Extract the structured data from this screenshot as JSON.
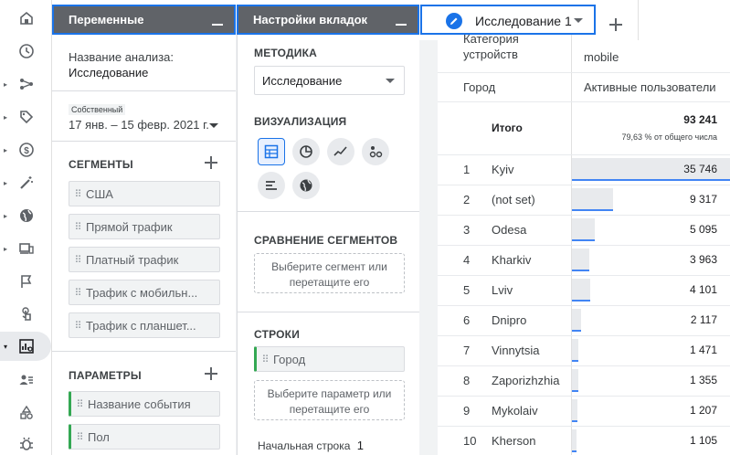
{
  "variables_panel": {
    "title": "Переменные",
    "analysis_name_label": "Название анализа:",
    "analysis_name_value": "Исследование",
    "date_badge": "Собственный",
    "date_range": "17 янв. – 15 февр. 2021 г.",
    "segments_title": "СЕГМЕНТЫ",
    "segments": [
      "США",
      "Прямой трафик",
      "Платный трафик",
      "Трафик с мобильн...",
      "Трафик с планшет..."
    ],
    "params_title": "ПАРАМЕТРЫ",
    "params": [
      "Название события",
      "Пол"
    ]
  },
  "settings_panel": {
    "title": "Настройки вкладок",
    "method_title": "МЕТОДИКА",
    "method_value": "Исследование",
    "viz_title": "ВИЗУАЛИЗАЦИЯ",
    "viz_icons": [
      "table-icon",
      "donut-chart-icon",
      "line-chart-icon",
      "scatter-chart-icon",
      "bar-chart-icon",
      "globe-icon"
    ],
    "segment_compare_title": "СРАВНЕНИЕ СЕГМЕНТОВ",
    "segment_drop_l1": "Выберите сегмент или",
    "segment_drop_l2": "перетащите его",
    "rows_title": "СТРОКИ",
    "rows_item": "Город",
    "rows_drop_l1": "Выберите параметр или",
    "rows_drop_l2": "перетащите его",
    "start_row_label": "Начальная строка",
    "start_row_value": "1"
  },
  "tab": {
    "label": "Исследование 1"
  },
  "table": {
    "device_category_header_l1": "Категория",
    "device_category_header_l2": "устройств",
    "device_value": "mobile",
    "city_header": "Город",
    "metric_header": "Активные пользователи",
    "total_label": "Итого",
    "total_value": "93 241",
    "total_sub": "79,63 % от общего числа",
    "rows": [
      {
        "n": "1",
        "city": "Kyiv",
        "value": "35 746",
        "share": 1.0
      },
      {
        "n": "2",
        "city": "(not set)",
        "value": "9 317",
        "share": 0.26
      },
      {
        "n": "3",
        "city": "Odesa",
        "value": "5 095",
        "share": 0.143
      },
      {
        "n": "4",
        "city": "Kharkiv",
        "value": "3 963",
        "share": 0.111
      },
      {
        "n": "5",
        "city": "Lviv",
        "value": "4 101",
        "share": 0.115
      },
      {
        "n": "6",
        "city": "Dnipro",
        "value": "2 117",
        "share": 0.059
      },
      {
        "n": "7",
        "city": "Vinnytsia",
        "value": "1 471",
        "share": 0.041
      },
      {
        "n": "8",
        "city": "Zaporizhzhia",
        "value": "1 355",
        "share": 0.038
      },
      {
        "n": "9",
        "city": "Mykolaiv",
        "value": "1 207",
        "share": 0.034
      },
      {
        "n": "10",
        "city": "Kherson",
        "value": "1 105",
        "share": 0.031
      }
    ]
  },
  "rail_icons": [
    "home-icon",
    "clock-icon",
    "flow-icon",
    "tag-icon",
    "dollar-icon",
    "magic-wand-icon",
    "globe-icon",
    "devices-icon",
    "flag-icon",
    "touch-icon",
    "explore-icon",
    "audience-icon",
    "shapes-icon",
    "debug-icon"
  ]
}
